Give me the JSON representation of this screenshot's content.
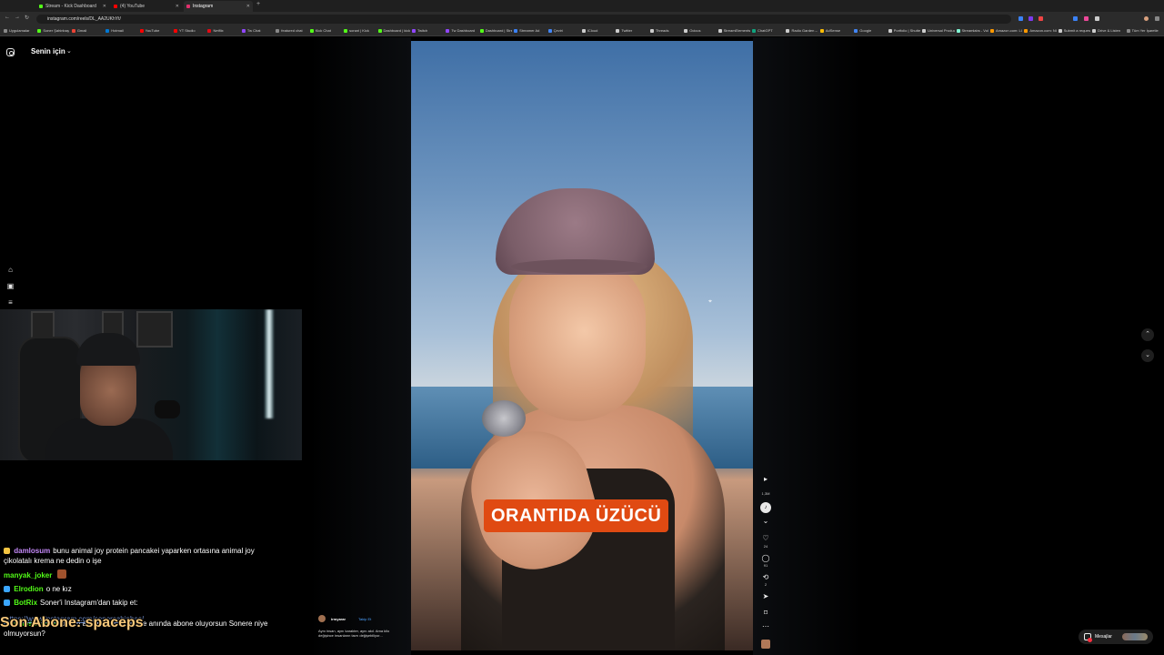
{
  "browser": {
    "tabs": [
      {
        "label": "Stream - Kick Dashboard",
        "color": "#53fc18",
        "active": false
      },
      {
        "label": "(4) YouTube",
        "color": "#ff0000",
        "active": false
      },
      {
        "label": "Instagram",
        "color": "#e1306c",
        "active": true
      }
    ],
    "url": "instagram.com/reels/DL_AA2UKhYt/",
    "bookmarks": [
      {
        "label": "Uygulamalar",
        "color": "#888888"
      },
      {
        "label": "Soner Şahinbaş",
        "color": "#53fc18"
      },
      {
        "label": "Gmail",
        "color": "#ea4335"
      },
      {
        "label": "Hotmail",
        "color": "#0078d4"
      },
      {
        "label": "YouTube",
        "color": "#ff0000"
      },
      {
        "label": "YT Studio",
        "color": "#ff0000"
      },
      {
        "label": "Netflix",
        "color": "#e50914"
      },
      {
        "label": "Tw Chat",
        "color": "#9146ff"
      },
      {
        "label": "featured chat",
        "color": "#888888"
      },
      {
        "label": "Kick Chat",
        "color": "#53fc18"
      },
      {
        "label": "sonari | Kick",
        "color": "#53fc18"
      },
      {
        "label": "Dashboard | kick",
        "color": "#53fc18"
      },
      {
        "label": "Twitch",
        "color": "#9146ff"
      },
      {
        "label": "Tw Dashboard",
        "color": "#9146ff"
      },
      {
        "label": "Dashboard | Strea...",
        "color": "#53fc18"
      },
      {
        "label": "Streamer Ad",
        "color": "#3b82f6"
      },
      {
        "label": "Çeviri",
        "color": "#4285f4"
      },
      {
        "label": "iCloud",
        "color": "#cccccc"
      },
      {
        "label": "Twitter",
        "color": "#cccccc"
      },
      {
        "label": "Threads",
        "color": "#cccccc"
      },
      {
        "label": "Ocicus",
        "color": "#cccccc"
      },
      {
        "label": "StreamElements",
        "color": "#cccccc"
      },
      {
        "label": "ChatGPT",
        "color": "#10a37f"
      },
      {
        "label": "Radio Garden – Kit...",
        "color": "#cccccc"
      },
      {
        "label": "AdSense",
        "color": "#fbbc05"
      },
      {
        "label": "Google",
        "color": "#4285f4"
      },
      {
        "label": "Portfolio | Shutters...",
        "color": "#cccccc"
      },
      {
        "label": "Universal Producti...",
        "color": "#cccccc"
      },
      {
        "label": "Streamlabs - Volu...",
        "color": "#80f5d2"
      },
      {
        "label": "Amazon.com: LG8...",
        "color": "#ff9900"
      },
      {
        "label": "Amazon.com: NCV...",
        "color": "#ff9900"
      },
      {
        "label": "Submit a request...",
        "color": "#cccccc"
      },
      {
        "label": "Drive & Listen",
        "color": "#cccccc"
      },
      {
        "label": "Tüm Yer İşaretleri",
        "color": "#888888"
      }
    ]
  },
  "sidebar": {
    "feed_title": "Senin için"
  },
  "chat": {
    "messages": [
      {
        "user": "damlosum",
        "user_color": "#c58af9",
        "text": "bunu animal joy protein pancakei yaparken ortasına animal joy çikolatalı krema ne dedin o işe",
        "badge_color": "#f5c542"
      },
      {
        "user": "manyak_joker",
        "user_color": "#53fc18",
        "text": "",
        "badge_color": "#a0522d"
      },
      {
        "user": "Elrodion",
        "user_color": "#53fc18",
        "text": "o ne kız",
        "badge_color": "#3ba7ff"
      },
      {
        "user": "BotRix",
        "user_color": "#53fc18",
        "text": "Soner'i Instagram'dan takip et:",
        "badge_color": "#3ba7ff"
      },
      {
        "user": "GhostMod0n",
        "user_color": "#53fc18",
        "text": "dimitri abone ol len diyince anında abone oluyorsun Sonere niye olmuyorsun?",
        "badge_color": "#3ba7ff"
      }
    ],
    "overlay_link": "https://www.instagram.com/sonersahinbas/",
    "last_subscriber": "Son Abone: spaceps"
  },
  "reel": {
    "caption": "ORANTIDA ÜZÜCÜ",
    "author": {
      "name": "irmyarar",
      "follow_label": "Takip Et",
      "description": "Aynı insan, aynı karakter, aynı akıl. Ama kilo değişince insanların tavrı değişebiliyor..."
    },
    "counts": {
      "views": "1,3M",
      "likes": "24",
      "comments": "91",
      "reposts": "2"
    },
    "icons": [
      "play-icon",
      "heart-icon",
      "comment-icon",
      "repost-icon",
      "send-icon",
      "bookmark-icon",
      "more-icon"
    ]
  },
  "messages_button": {
    "label": "Mesajlar"
  }
}
